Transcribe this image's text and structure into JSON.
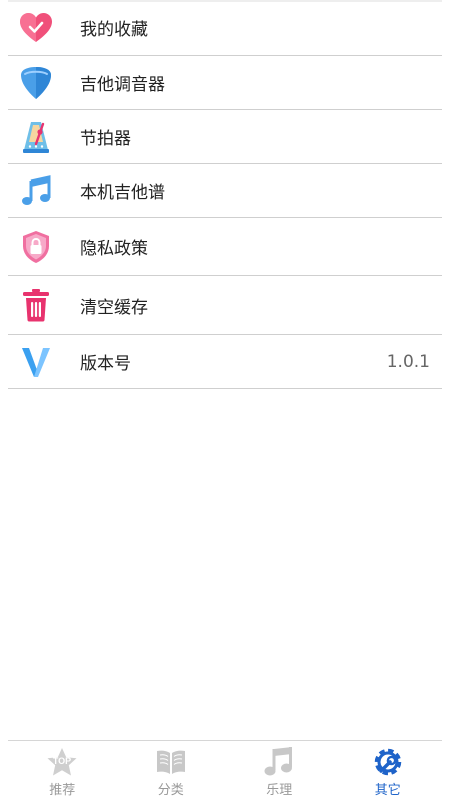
{
  "menu": {
    "items": [
      {
        "label": "我的收藏",
        "icon": "heart-check-icon"
      },
      {
        "label": "吉他调音器",
        "icon": "guitar-pick-icon"
      },
      {
        "label": "节拍器",
        "icon": "metronome-icon"
      },
      {
        "label": "本机吉他谱",
        "icon": "music-note-icon"
      },
      {
        "label": "隐私政策",
        "icon": "lock-shield-icon"
      },
      {
        "label": "清空缓存",
        "icon": "trash-icon"
      },
      {
        "label": "版本号",
        "icon": "version-v-icon",
        "value": "1.0.1"
      }
    ]
  },
  "tabbar": {
    "tabs": [
      {
        "label": "推荐",
        "icon": "top-star-icon",
        "icon_text": "TOP",
        "active": false
      },
      {
        "label": "分类",
        "icon": "open-book-icon",
        "active": false
      },
      {
        "label": "乐理",
        "icon": "music-note-icon",
        "active": false
      },
      {
        "label": "其它",
        "icon": "gear-wrench-icon",
        "active": true
      }
    ]
  },
  "colors": {
    "accent": "#1e63c9",
    "inactive": "#999999",
    "heart": "#f0507a",
    "pick": "#4a9fe8",
    "note": "#4a9fe8",
    "shield": "#f06fa0",
    "trash": "#e8336e",
    "version": "#3aa0f0"
  }
}
